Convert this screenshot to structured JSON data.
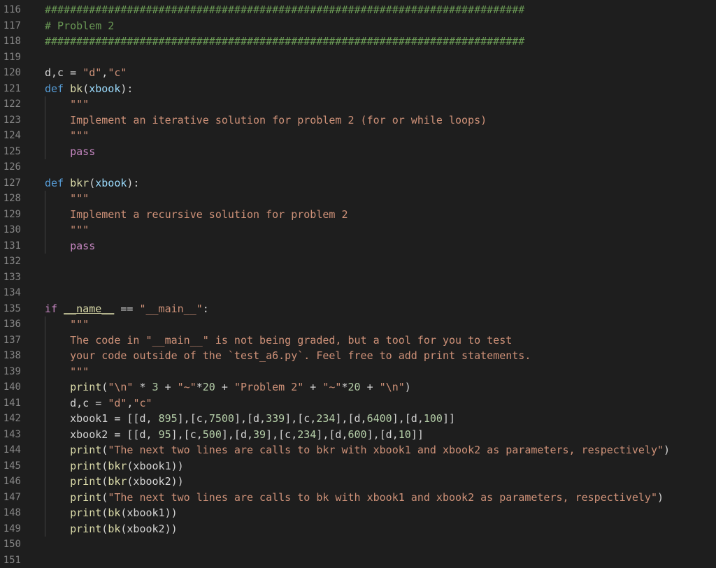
{
  "editor": {
    "lines": [
      {
        "n": "116",
        "segments": [
          {
            "t": "############################################################################",
            "c": "cmt"
          }
        ]
      },
      {
        "n": "117",
        "segments": [
          {
            "t": "# Problem 2",
            "c": "cmt"
          }
        ]
      },
      {
        "n": "118",
        "segments": [
          {
            "t": "############################################################################",
            "c": "cmt"
          }
        ]
      },
      {
        "n": "119",
        "segments": []
      },
      {
        "n": "120",
        "segments": [
          {
            "t": "d,c = ",
            "c": ""
          },
          {
            "t": "\"d\"",
            "c": "str"
          },
          {
            "t": ",",
            "c": ""
          },
          {
            "t": "\"c\"",
            "c": "str"
          }
        ]
      },
      {
        "n": "121",
        "segments": [
          {
            "t": "def",
            "c": "kw"
          },
          {
            "t": " ",
            "c": ""
          },
          {
            "t": "bk",
            "c": "fn"
          },
          {
            "t": "(",
            "c": ""
          },
          {
            "t": "xbook",
            "c": "par"
          },
          {
            "t": "):",
            "c": ""
          }
        ]
      },
      {
        "n": "122",
        "guide": true,
        "segments": [
          {
            "t": "    ",
            "c": ""
          },
          {
            "t": "\"\"\"",
            "c": "str"
          }
        ]
      },
      {
        "n": "123",
        "guide": true,
        "segments": [
          {
            "t": "    Implement an iterative solution for problem 2 (for or while loops)",
            "c": "str"
          }
        ]
      },
      {
        "n": "124",
        "guide": true,
        "segments": [
          {
            "t": "    ",
            "c": ""
          },
          {
            "t": "\"\"\"",
            "c": "str"
          }
        ]
      },
      {
        "n": "125",
        "guide": true,
        "segments": [
          {
            "t": "    ",
            "c": ""
          },
          {
            "t": "pass",
            "c": "ctl"
          }
        ]
      },
      {
        "n": "126",
        "segments": []
      },
      {
        "n": "127",
        "segments": [
          {
            "t": "def",
            "c": "kw"
          },
          {
            "t": " ",
            "c": ""
          },
          {
            "t": "bkr",
            "c": "fn"
          },
          {
            "t": "(",
            "c": ""
          },
          {
            "t": "xbook",
            "c": "par"
          },
          {
            "t": "):",
            "c": ""
          }
        ]
      },
      {
        "n": "128",
        "guide": true,
        "segments": [
          {
            "t": "    ",
            "c": ""
          },
          {
            "t": "\"\"\"",
            "c": "str"
          }
        ]
      },
      {
        "n": "129",
        "guide": true,
        "segments": [
          {
            "t": "    Implement a recursive solution for problem 2",
            "c": "str"
          }
        ]
      },
      {
        "n": "130",
        "guide": true,
        "segments": [
          {
            "t": "    ",
            "c": ""
          },
          {
            "t": "\"\"\"",
            "c": "str"
          }
        ]
      },
      {
        "n": "131",
        "guide": true,
        "segments": [
          {
            "t": "    ",
            "c": ""
          },
          {
            "t": "pass",
            "c": "ctl"
          }
        ]
      },
      {
        "n": "132",
        "segments": []
      },
      {
        "n": "133",
        "segments": []
      },
      {
        "n": "134",
        "segments": []
      },
      {
        "n": "135",
        "segments": [
          {
            "t": "if",
            "c": "ctl"
          },
          {
            "t": " ",
            "c": ""
          },
          {
            "t": "__name__",
            "c": "dnd"
          },
          {
            "t": " == ",
            "c": ""
          },
          {
            "t": "\"__main__\"",
            "c": "str"
          },
          {
            "t": ":",
            "c": ""
          }
        ]
      },
      {
        "n": "136",
        "guide": true,
        "segments": [
          {
            "t": "    ",
            "c": ""
          },
          {
            "t": "\"\"\"",
            "c": "str"
          }
        ]
      },
      {
        "n": "137",
        "guide": true,
        "segments": [
          {
            "t": "    The code in \"__main__\" is not being graded, but a tool for you to test",
            "c": "str"
          }
        ]
      },
      {
        "n": "138",
        "guide": true,
        "segments": [
          {
            "t": "    your code outside of the `test_a6.py`. Feel free to add print statements.",
            "c": "str"
          }
        ]
      },
      {
        "n": "139",
        "guide": true,
        "segments": [
          {
            "t": "    ",
            "c": ""
          },
          {
            "t": "\"\"\"",
            "c": "str"
          }
        ]
      },
      {
        "n": "140",
        "guide": true,
        "segments": [
          {
            "t": "    ",
            "c": ""
          },
          {
            "t": "print",
            "c": "fn"
          },
          {
            "t": "(",
            "c": ""
          },
          {
            "t": "\"\\n\"",
            "c": "str"
          },
          {
            "t": " * ",
            "c": ""
          },
          {
            "t": "3",
            "c": "num"
          },
          {
            "t": " + ",
            "c": ""
          },
          {
            "t": "\"~\"",
            "c": "str"
          },
          {
            "t": "*",
            "c": ""
          },
          {
            "t": "20",
            "c": "num"
          },
          {
            "t": " + ",
            "c": ""
          },
          {
            "t": "\"Problem 2\"",
            "c": "str"
          },
          {
            "t": " + ",
            "c": ""
          },
          {
            "t": "\"~\"",
            "c": "str"
          },
          {
            "t": "*",
            "c": ""
          },
          {
            "t": "20",
            "c": "num"
          },
          {
            "t": " + ",
            "c": ""
          },
          {
            "t": "\"\\n\"",
            "c": "str"
          },
          {
            "t": ")",
            "c": ""
          }
        ]
      },
      {
        "n": "141",
        "guide": true,
        "segments": [
          {
            "t": "    d,c = ",
            "c": ""
          },
          {
            "t": "\"d\"",
            "c": "str"
          },
          {
            "t": ",",
            "c": ""
          },
          {
            "t": "\"c\"",
            "c": "str"
          }
        ]
      },
      {
        "n": "142",
        "guide": true,
        "segments": [
          {
            "t": "    xbook1 = [[d, ",
            "c": ""
          },
          {
            "t": "895",
            "c": "num"
          },
          {
            "t": "],[c,",
            "c": ""
          },
          {
            "t": "7500",
            "c": "num"
          },
          {
            "t": "],[d,",
            "c": ""
          },
          {
            "t": "339",
            "c": "num"
          },
          {
            "t": "],[c,",
            "c": ""
          },
          {
            "t": "234",
            "c": "num"
          },
          {
            "t": "],[d,",
            "c": ""
          },
          {
            "t": "6400",
            "c": "num"
          },
          {
            "t": "],[d,",
            "c": ""
          },
          {
            "t": "100",
            "c": "num"
          },
          {
            "t": "]]",
            "c": ""
          }
        ]
      },
      {
        "n": "143",
        "guide": true,
        "segments": [
          {
            "t": "    xbook2 = [[d, ",
            "c": ""
          },
          {
            "t": "95",
            "c": "num"
          },
          {
            "t": "],[c,",
            "c": ""
          },
          {
            "t": "500",
            "c": "num"
          },
          {
            "t": "],[d,",
            "c": ""
          },
          {
            "t": "39",
            "c": "num"
          },
          {
            "t": "],[c,",
            "c": ""
          },
          {
            "t": "234",
            "c": "num"
          },
          {
            "t": "],[d,",
            "c": ""
          },
          {
            "t": "600",
            "c": "num"
          },
          {
            "t": "],[d,",
            "c": ""
          },
          {
            "t": "10",
            "c": "num"
          },
          {
            "t": "]]",
            "c": ""
          }
        ]
      },
      {
        "n": "144",
        "guide": true,
        "segments": [
          {
            "t": "    ",
            "c": ""
          },
          {
            "t": "print",
            "c": "fn"
          },
          {
            "t": "(",
            "c": ""
          },
          {
            "t": "\"The next two lines are calls to bkr with xbook1 and xbook2 as parameters, respectively\"",
            "c": "str"
          },
          {
            "t": ")",
            "c": ""
          }
        ]
      },
      {
        "n": "145",
        "guide": true,
        "segments": [
          {
            "t": "    ",
            "c": ""
          },
          {
            "t": "print",
            "c": "fn"
          },
          {
            "t": "(",
            "c": ""
          },
          {
            "t": "bkr",
            "c": "fn"
          },
          {
            "t": "(xbook1))",
            "c": ""
          }
        ]
      },
      {
        "n": "146",
        "guide": true,
        "segments": [
          {
            "t": "    ",
            "c": ""
          },
          {
            "t": "print",
            "c": "fn"
          },
          {
            "t": "(",
            "c": ""
          },
          {
            "t": "bkr",
            "c": "fn"
          },
          {
            "t": "(xbook2))",
            "c": ""
          }
        ]
      },
      {
        "n": "147",
        "guide": true,
        "segments": [
          {
            "t": "    ",
            "c": ""
          },
          {
            "t": "print",
            "c": "fn"
          },
          {
            "t": "(",
            "c": ""
          },
          {
            "t": "\"The next two lines are calls to bk with xbook1 and xbook2 as parameters, respectively\"",
            "c": "str"
          },
          {
            "t": ")",
            "c": ""
          }
        ]
      },
      {
        "n": "148",
        "guide": true,
        "segments": [
          {
            "t": "    ",
            "c": ""
          },
          {
            "t": "print",
            "c": "fn"
          },
          {
            "t": "(",
            "c": ""
          },
          {
            "t": "bk",
            "c": "fn"
          },
          {
            "t": "(xbook1))",
            "c": ""
          }
        ]
      },
      {
        "n": "149",
        "guide": true,
        "segments": [
          {
            "t": "    ",
            "c": ""
          },
          {
            "t": "print",
            "c": "fn"
          },
          {
            "t": "(",
            "c": ""
          },
          {
            "t": "bk",
            "c": "fn"
          },
          {
            "t": "(xbook2))",
            "c": ""
          }
        ]
      },
      {
        "n": "150",
        "segments": []
      },
      {
        "n": "151",
        "segments": []
      }
    ]
  }
}
